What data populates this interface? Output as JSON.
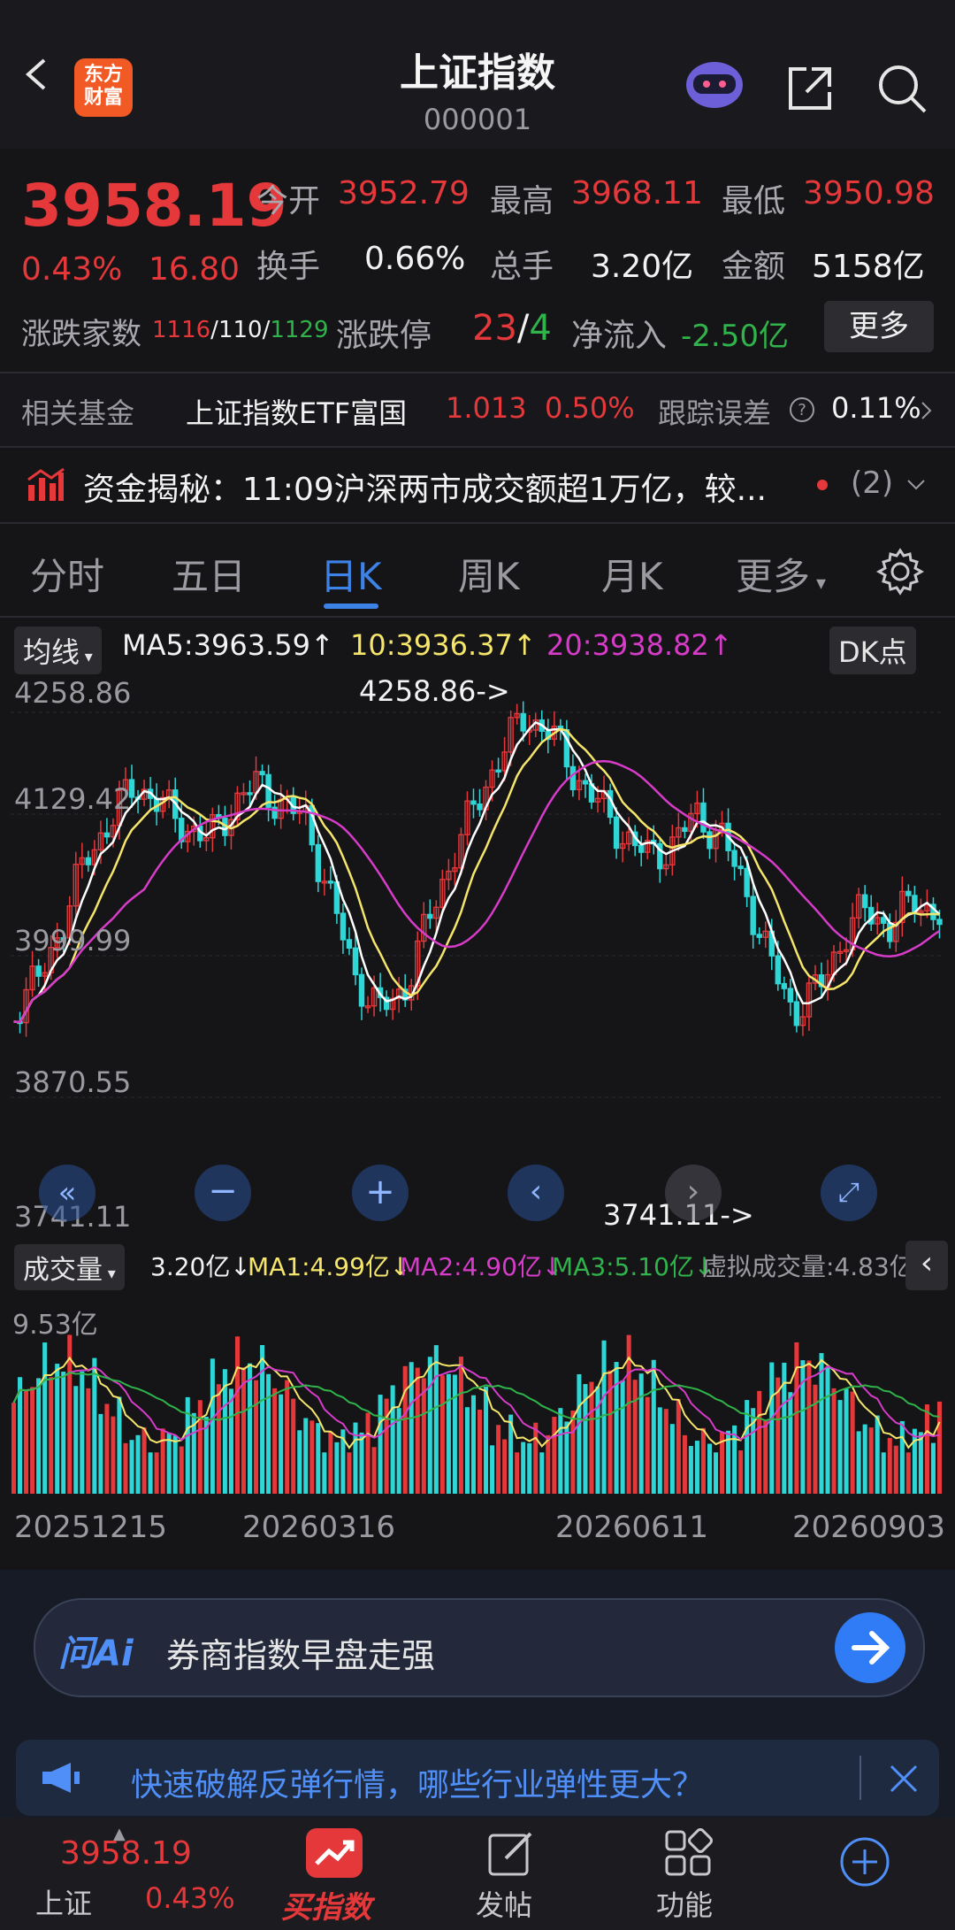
{
  "header": {
    "title": "上证指数",
    "code": "000001",
    "brand_lines": [
      "东方",
      "财富"
    ]
  },
  "quote": {
    "price": "3958.19",
    "change_pct": "0.43%",
    "change": "16.80",
    "open_label": "今开",
    "open": "3952.79",
    "high_label": "最高",
    "high": "3968.11",
    "low_label": "最低",
    "low": "3950.98",
    "turnover_label": "换手",
    "turnover": "0.66%",
    "volume_label": "总手",
    "volume": "3.20亿",
    "amount_label": "金额",
    "amount": "5158亿",
    "breadth_label": "涨跌家数",
    "breadth_up": "1116",
    "breadth_flat": "110",
    "breadth_down": "1129",
    "limit_label": "涨跌停",
    "limit_up": "23",
    "limit_down": "4",
    "netflow_label": "净流入",
    "netflow": "-2.50亿",
    "more_button": "更多"
  },
  "fund": {
    "label": "相关基金",
    "name": "上证指数ETF富国",
    "price": "1.013",
    "pct": "0.50%",
    "tracking_label": "跟踪误差",
    "tracking": "0.11%"
  },
  "news": {
    "text": "资金揭秘：11:09沪深两市成交额超1万亿，较...",
    "count": "(2)"
  },
  "tabs": [
    "分时",
    "五日",
    "日K",
    "周K",
    "月K",
    "更多"
  ],
  "ma_legend": {
    "selector": "均线",
    "ma5": "MA5:3963.59↑",
    "ma10": "10:3936.37↑",
    "ma20": "20:3938.82↑",
    "dk_button": "DK点"
  },
  "price_axis": [
    "4258.86",
    "4129.42",
    "3999.99",
    "3870.55",
    "3741.11"
  ],
  "annotations": {
    "high": "4258.86->",
    "low": "3741.11->"
  },
  "volume_legend": {
    "selector": "成交量",
    "value": "3.20亿↓",
    "ma1": "MA1:4.99亿↓",
    "ma2": "MA2:4.90亿↓",
    "ma3": "MA3:5.10亿↓",
    "virtual": "虚拟成交量:4.83亿",
    "axis_top": "9.53亿"
  },
  "date_axis": [
    "20251215",
    "20260316",
    "20260611",
    "20260903"
  ],
  "ai": {
    "logo": "问Ai",
    "prompt": "券商指数早盘走强"
  },
  "banner": {
    "text": "快速破解反弹行情，哪些行业弹性更大？"
  },
  "bottom_nav": {
    "index_price": "3958.19",
    "index_name": "上证",
    "index_pct": "0.43%",
    "buy": "买指数",
    "post": "发帖",
    "func": "功能"
  },
  "colors": {
    "up": "#e5383b",
    "down": "#2fd6d6",
    "accent": "#3d82e6",
    "ma5": "#ffffff",
    "ma10": "#f5e66b",
    "ma20": "#d63cc8"
  }
}
